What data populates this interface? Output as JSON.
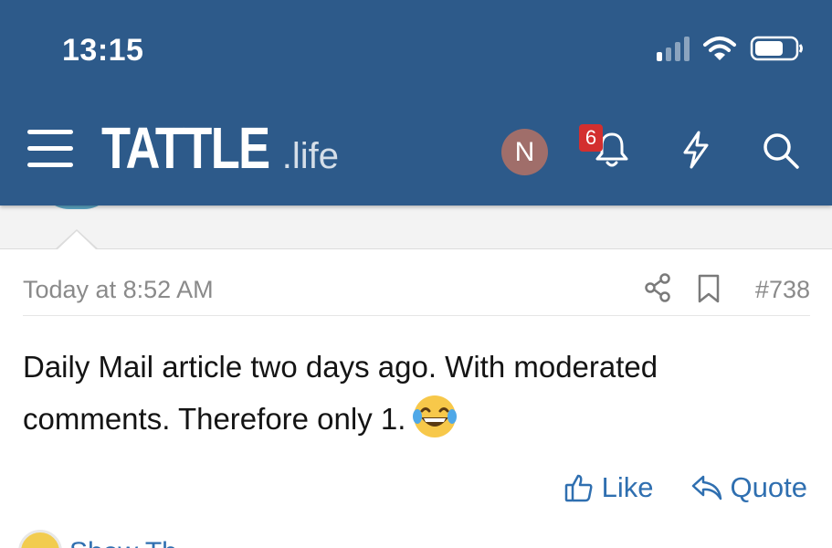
{
  "status_bar": {
    "time": "13:15",
    "signal_bars_on": 1,
    "signal_bars_total": 4,
    "battery_level": 0.65
  },
  "header": {
    "logo_main": "TATTLE",
    "logo_sub": ".life",
    "avatar_initial": "N",
    "notification_count": "6",
    "icons": [
      "menu-icon",
      "bell-icon",
      "bolt-icon",
      "search-icon"
    ]
  },
  "post": {
    "date": "Today at 8:52 AM",
    "number": "#738",
    "body": "Daily Mail article two days ago. With moderated comments. Therefore only 1.",
    "emoji": "face-with-tears-of-joy",
    "actions": {
      "like_label": "Like",
      "quote_label": "Quote"
    }
  },
  "next_post": {
    "author": "Show Th"
  },
  "colors": {
    "header_bg": "#2d5a8a",
    "link": "#2f6fb0",
    "badge": "#d32f2f",
    "avatar": "#a06e6a"
  }
}
